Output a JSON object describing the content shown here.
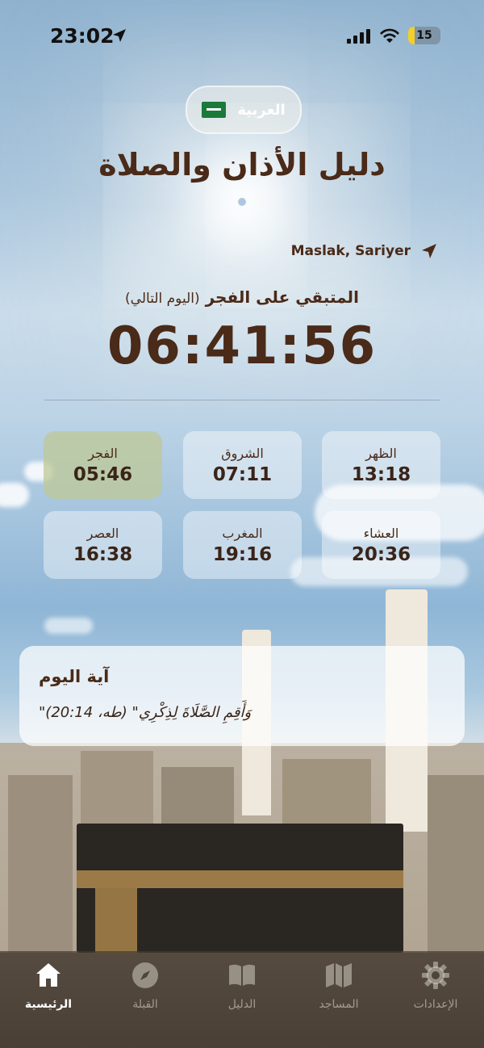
{
  "status_bar": {
    "time": "23:02",
    "battery": "15"
  },
  "language": {
    "label": "العربية",
    "flag_icon": "saudi-flag-icon"
  },
  "app_title": "دليل الأذان والصلاة",
  "location": "Maslak, Sariyer",
  "countdown": {
    "label": "المتبقي على الفجر",
    "sublabel": "(اليوم التالي)",
    "value": "06:41:56"
  },
  "prayers": [
    {
      "name": "الظهر",
      "time": "13:18",
      "active": false
    },
    {
      "name": "الشروق",
      "time": "07:11",
      "active": false
    },
    {
      "name": "الفجر",
      "time": "05:46",
      "active": true
    },
    {
      "name": "العشاء",
      "time": "20:36",
      "active": false
    },
    {
      "name": "المغرب",
      "time": "19:16",
      "active": false
    },
    {
      "name": "العصر",
      "time": "16:38",
      "active": false
    }
  ],
  "ayah": {
    "title": "آية اليوم",
    "text": "\"وَأَقِمِ الصَّلَاةَ لِذِكْرِي\" (طه، 20:14)"
  },
  "tabs": [
    {
      "label": "الرئيسية",
      "icon": "home-icon",
      "active": true
    },
    {
      "label": "القبلة",
      "icon": "compass-icon",
      "active": false
    },
    {
      "label": "الدليل",
      "icon": "book-icon",
      "active": false
    },
    {
      "label": "المساجد",
      "icon": "map-icon",
      "active": false
    },
    {
      "label": "الإعدادات",
      "icon": "gear-icon",
      "active": false
    }
  ],
  "colors": {
    "accent": "#4a2a18",
    "active_card": "#c8cfa0",
    "battery": "#f3cf2b"
  }
}
